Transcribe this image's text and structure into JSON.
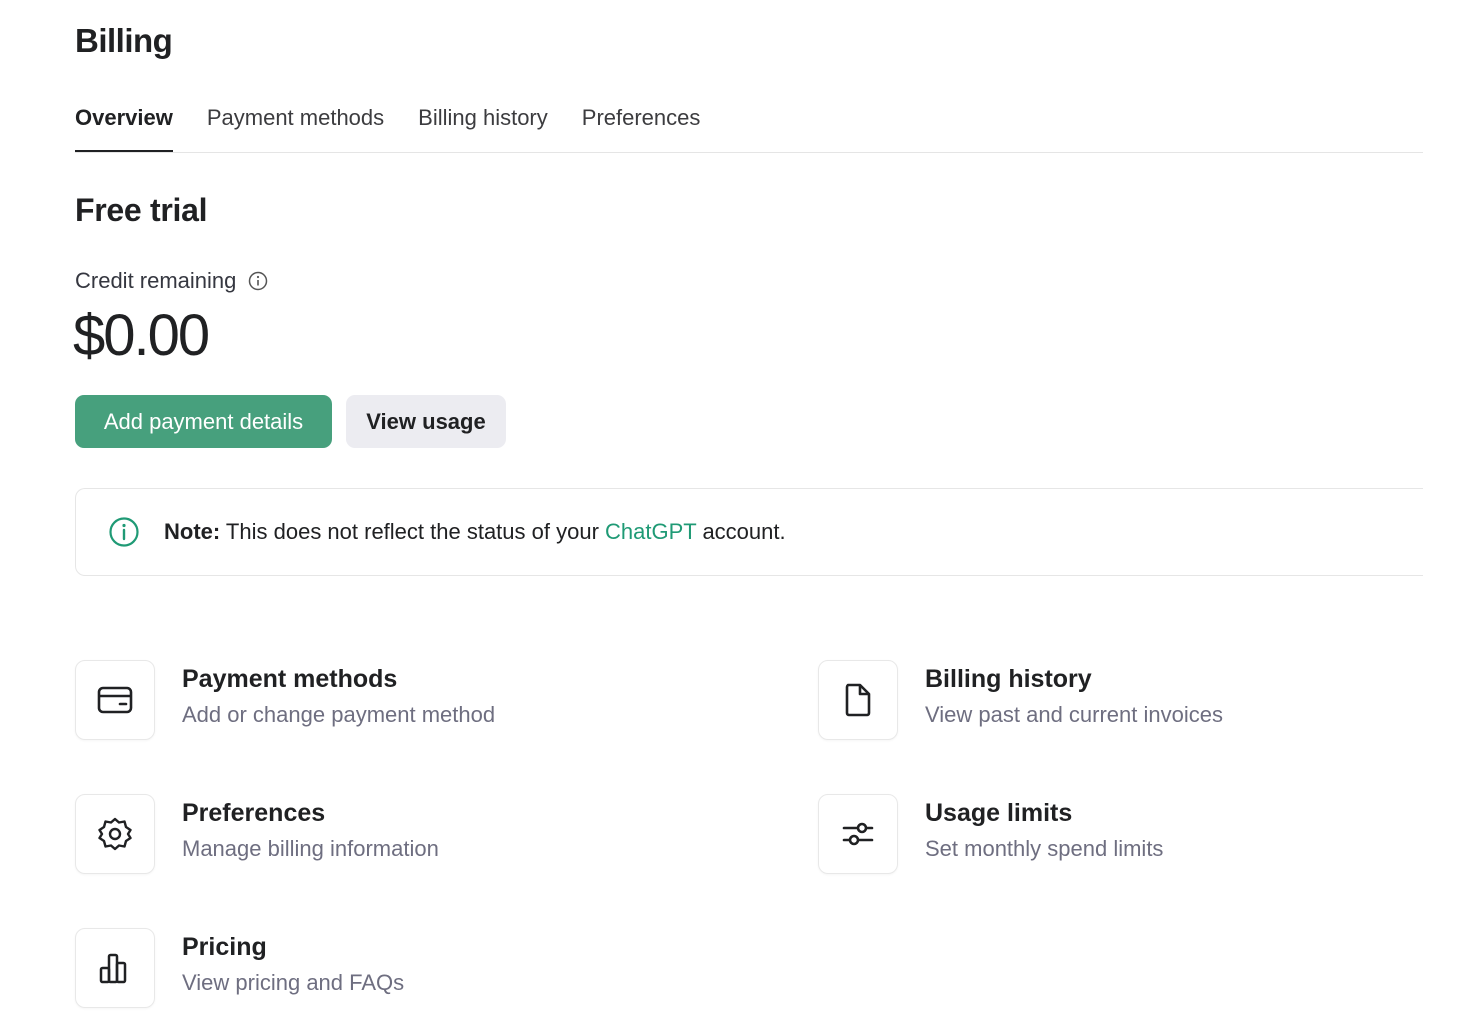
{
  "page": {
    "title": "Billing"
  },
  "tabs": [
    {
      "label": "Overview",
      "active": true
    },
    {
      "label": "Payment methods",
      "active": false
    },
    {
      "label": "Billing history",
      "active": false
    },
    {
      "label": "Preferences",
      "active": false
    }
  ],
  "plan": {
    "title": "Free trial",
    "credit_label": "Credit remaining",
    "credit_amount": "$0.00"
  },
  "actions": {
    "add_payment": "Add payment details",
    "view_usage": "View usage"
  },
  "note": {
    "prefix": "Note:",
    "text_before": " This does not reflect the status of your ",
    "link": "ChatGPT",
    "text_after": " account."
  },
  "cards": [
    {
      "title": "Payment methods",
      "description": "Add or change payment method",
      "icon": "credit-card-icon"
    },
    {
      "title": "Billing history",
      "description": "View past and current invoices",
      "icon": "document-icon"
    },
    {
      "title": "Preferences",
      "description": "Manage billing information",
      "icon": "gear-icon"
    },
    {
      "title": "Usage limits",
      "description": "Set monthly spend limits",
      "icon": "sliders-icon"
    },
    {
      "title": "Pricing",
      "description": "View pricing and FAQs",
      "icon": "bar-chart-icon"
    }
  ],
  "colors": {
    "accent": "#47a07d",
    "link": "#1f9a75",
    "secondary_button": "#ececf1"
  }
}
